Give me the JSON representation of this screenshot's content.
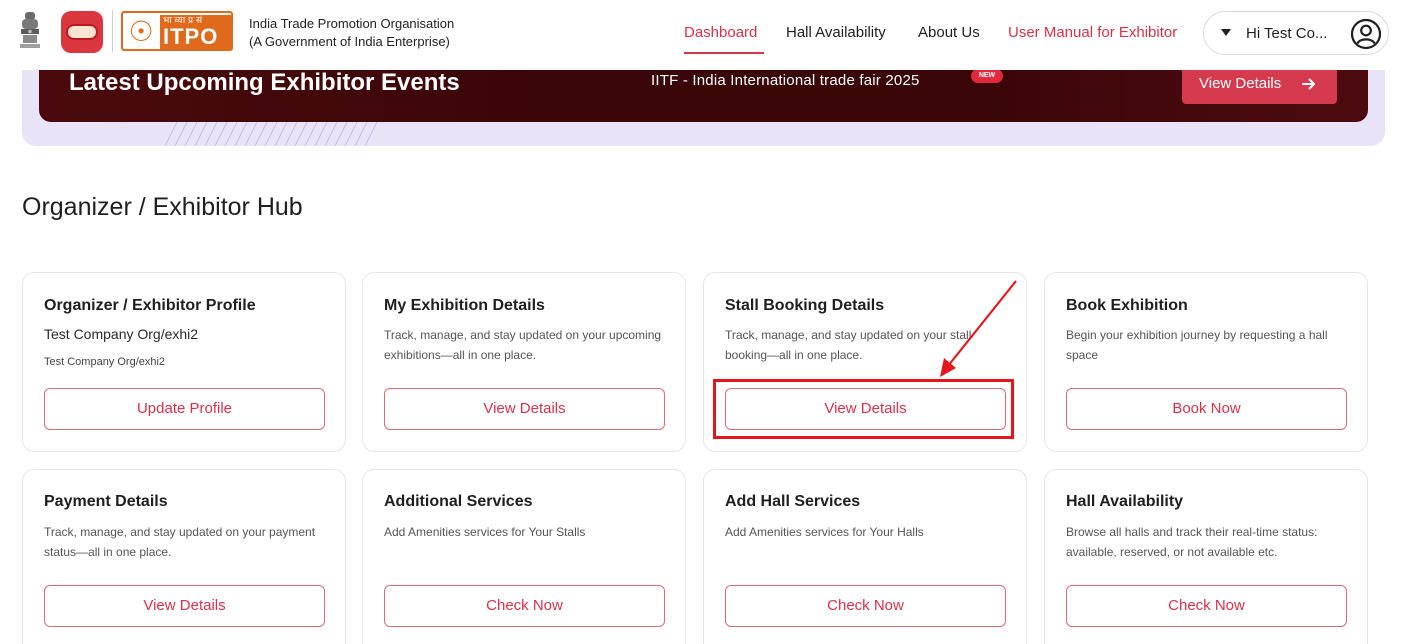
{
  "header": {
    "org_line1": "India Trade Promotion Organisation",
    "org_line2": "(A Government of India Enterprise)",
    "itpo_hindi": "भा व्या प्र सं",
    "itpo_word": "ITPO",
    "nav": [
      {
        "label": "Dashboard",
        "active": true,
        "color": "#d6324a"
      },
      {
        "label": "Hall Availability",
        "active": false
      },
      {
        "label": "About Us",
        "active": false
      },
      {
        "label": "User Manual for Exhibitor",
        "active": false,
        "color": "#d6324a"
      }
    ],
    "user_greeting": "Hi Test Co...",
    "icons": {
      "emblem": "national-emblem-icon",
      "brand": "brand-logo-icon",
      "caret": "caret-down-icon",
      "avatar": "user-avatar-icon"
    }
  },
  "banner": {
    "title": "Latest Upcoming Exhibitor Events",
    "event": "IITF - India International trade fair 2025",
    "badge": "NEW",
    "button_label": "View Details",
    "button_icon": "arrow-right-icon"
  },
  "section_title": "Organizer / Exhibitor Hub",
  "cards": [
    {
      "title": "Organizer / Exhibitor Profile",
      "subtitle": "Test Company Org/exhi2",
      "subtitle2": "Test Company Org/exhi2",
      "button": "Update Profile"
    },
    {
      "title": "My Exhibition Details",
      "desc": "Track, manage, and stay updated on your upcoming exhibitions—all in one place.",
      "button": "View Details"
    },
    {
      "title": "Stall Booking Details",
      "desc": "Track, manage, and stay updated on your stall booking—all in one place.",
      "button": "View Details"
    },
    {
      "title": "Book Exhibition",
      "desc": "Begin your exhibition journey by requesting a hall space",
      "button": "Book Now"
    },
    {
      "title": "Payment Details",
      "desc": "Track, manage, and stay updated on your payment status—all in one place.",
      "button": "View Details"
    },
    {
      "title": "Additional Services",
      "desc": "Add Amenities services for Your Stalls",
      "button": "Check Now"
    },
    {
      "title": "Add Hall Services",
      "desc": "Add Amenities services for Your Halls",
      "button": "Check Now"
    },
    {
      "title": "Hall Availability",
      "desc": "Browse all halls and track their real-time status: available, reserved, or not available etc.",
      "button": "Check Now"
    }
  ],
  "colors": {
    "accent": "#d6324a",
    "banner_bg": "#3a0608",
    "banner_outer": "#e9e3f7",
    "itpo_orange": "#e06a1b",
    "annotation": "#e5151d"
  }
}
